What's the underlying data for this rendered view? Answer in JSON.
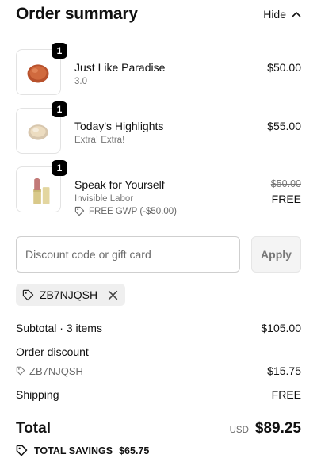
{
  "header": {
    "title": "Order summary",
    "toggle_label": "Hide"
  },
  "items": [
    {
      "quantity": "1",
      "name": "Just Like Paradise",
      "variant": "3.0",
      "price": "$50.00",
      "image": "compact-powder-icon"
    },
    {
      "quantity": "1",
      "name": "Today's Highlights",
      "variant": "Extra! Extra!",
      "price": "$55.00",
      "image": "highlighter-compact-icon"
    },
    {
      "quantity": "1",
      "name": "Speak for Yourself",
      "variant": "Invisible Labor",
      "gwp": "FREE GWP (-$50.00)",
      "original_price": "$50.00",
      "price": "FREE",
      "image": "lipstick-icon"
    }
  ],
  "discount": {
    "placeholder": "Discount code or gift card",
    "value": "",
    "apply_label": "Apply"
  },
  "applied_code": "ZB7NJQSH",
  "summary": {
    "subtotal_label": "Subtotal · 3 items",
    "subtotal_value": "$105.00",
    "discount_label": "Order discount",
    "discount_code": "ZB7NJQSH",
    "discount_value": "– $15.75",
    "shipping_label": "Shipping",
    "shipping_value": "FREE"
  },
  "total": {
    "label": "Total",
    "currency": "USD",
    "amount": "$89.25"
  },
  "savings": {
    "label": "TOTAL SAVINGS",
    "amount": "$65.75"
  }
}
